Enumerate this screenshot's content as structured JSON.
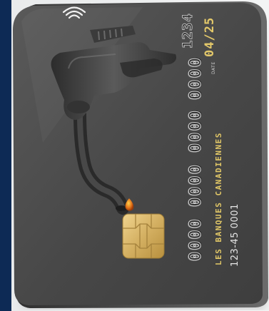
{
  "card": {
    "number_groups": [
      "0000",
      "0000",
      "0000",
      "0000",
      "1234"
    ],
    "expiry_label": "DATE",
    "expiry_value": "04/25",
    "bank_name": "LES BANQUES CANADIENNES",
    "account_number": "123-45 0001"
  },
  "colors": {
    "frame_left": "#0d2a55",
    "background": "#eef0f0",
    "card_body": "#4a4a4a",
    "card_gold_text": "#e1c767",
    "chip_gold": "#d8b86a",
    "nozzle": "#3a3a3a",
    "fuel_drop": "#e07a1c"
  },
  "icons": [
    "contactless-icon",
    "chip-icon",
    "fuel-nozzle-icon",
    "fuel-drop-icon"
  ]
}
